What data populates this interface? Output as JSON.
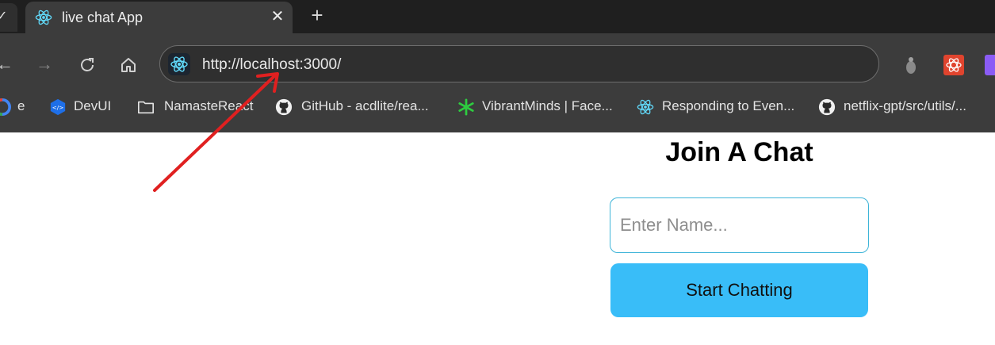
{
  "tab": {
    "title": "live chat App",
    "close_glyph": "✕",
    "new_tab_glyph": "+"
  },
  "toolbar": {
    "url": "http://localhost:3000/"
  },
  "bookmarks": [
    {
      "label": "e",
      "icon": "google-icon"
    },
    {
      "label": "DevUI",
      "icon": "devui-icon"
    },
    {
      "label": "NamasteReact",
      "icon": "folder-icon"
    },
    {
      "label": "GitHub - acdlite/rea...",
      "icon": "github-icon"
    },
    {
      "label": "VibrantMinds | Face...",
      "icon": "asterisk-icon"
    },
    {
      "label": "Responding to Even...",
      "icon": "react-icon"
    },
    {
      "label": "netflix-gpt/src/utils/...",
      "icon": "github-icon"
    }
  ],
  "page": {
    "title": "Join A Chat",
    "name_placeholder": "Enter Name...",
    "start_button": "Start Chatting"
  },
  "colors": {
    "accent": "#39bdf8",
    "input_border": "#3eb4d8",
    "annotation_arrow": "#e02020",
    "chrome": "#3c3c3c"
  }
}
